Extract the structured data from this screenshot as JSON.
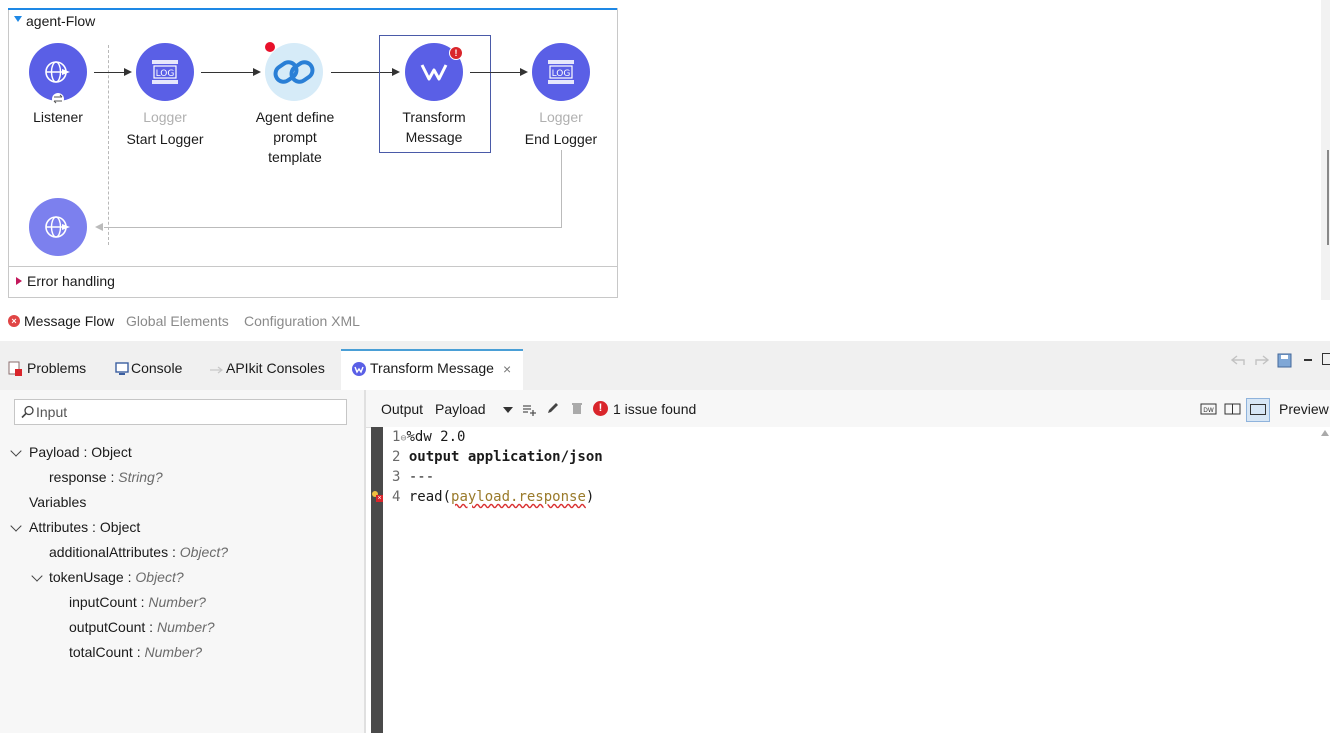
{
  "flow": {
    "name": "agent-Flow",
    "error_handling": "Error handling",
    "nodes": {
      "listener": {
        "label": "Listener"
      },
      "start_logger": {
        "type": "Logger",
        "label": "Start Logger"
      },
      "agent": {
        "label_line1": "Agent define",
        "label_line2": "prompt",
        "label_line3": "template"
      },
      "transform": {
        "label_line1": "Transform",
        "label_line2": "Message"
      },
      "end_logger": {
        "type": "Logger",
        "label": "End Logger"
      }
    },
    "log_icon_text": "LOG",
    "node_color": "#5a5fe6"
  },
  "editor_tabs": {
    "message_flow": "Message Flow",
    "global_elements": "Global Elements",
    "configuration_xml": "Configuration XML"
  },
  "panel_tabs": {
    "problems": "Problems",
    "console": "Console",
    "apikit": "APIkit Consoles",
    "transform": "Transform Message"
  },
  "input_pane": {
    "search_placeholder": "Input",
    "tree": {
      "payload": {
        "name": "Payload",
        "type": "Object"
      },
      "response": {
        "name": "response",
        "type": "String?"
      },
      "variables": "Variables",
      "attributes": {
        "name": "Attributes",
        "type": "Object"
      },
      "additional": {
        "name": "additionalAttributes",
        "type": "Object?"
      },
      "token": {
        "name": "tokenUsage",
        "type": "Object?"
      },
      "input_count": {
        "name": "inputCount",
        "type": "Number?"
      },
      "output_count": {
        "name": "outputCount",
        "type": "Number?"
      },
      "total_count": {
        "name": "totalCount",
        "type": "Number?"
      }
    }
  },
  "output_pane": {
    "output_label": "Output",
    "target": "Payload",
    "issues": "1 issue found",
    "preview": "Preview"
  },
  "code": {
    "line1": "%dw 2.0",
    "line2": "output application/json",
    "line3": "---",
    "line4_a": "read(",
    "line4_b": "payload.response",
    "line4_c": ")"
  }
}
